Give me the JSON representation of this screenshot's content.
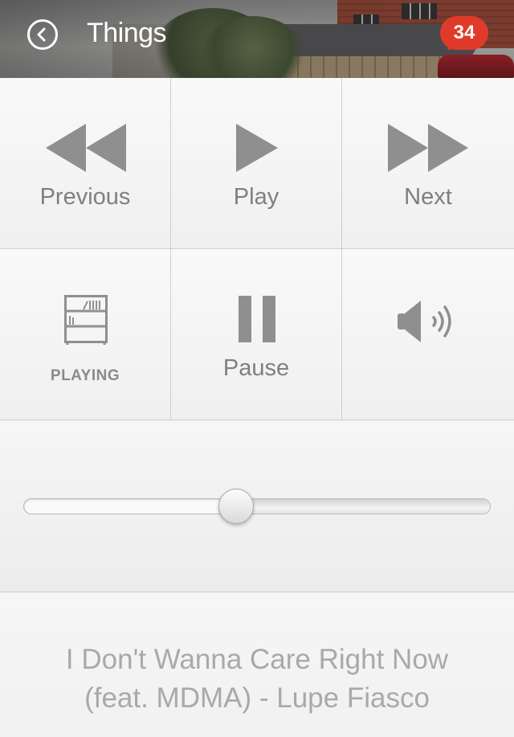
{
  "header": {
    "title": "Things",
    "notification_count": "34",
    "back_icon": "back-circle-icon"
  },
  "controls": {
    "previous": {
      "label": "Previous",
      "icon": "rewind-icon"
    },
    "play": {
      "label": "Play",
      "icon": "play-icon"
    },
    "next": {
      "label": "Next",
      "icon": "fast-forward-icon"
    },
    "library": {
      "label": "PLAYING",
      "icon": "bookshelf-icon"
    },
    "pause": {
      "label": "Pause",
      "icon": "pause-icon"
    },
    "volume": {
      "icon": "speaker-volume-icon"
    }
  },
  "slider": {
    "value_fraction": 0.455
  },
  "now_playing": {
    "line1": "I Don't Wanna Care Right Now",
    "line2": "(feat. MDMA) - Lupe Fiasco"
  },
  "colors": {
    "badge": "#e23a2a",
    "icon": "#8f8f8f",
    "label": "#7f7f7f",
    "song_text": "#a9a9a9"
  }
}
